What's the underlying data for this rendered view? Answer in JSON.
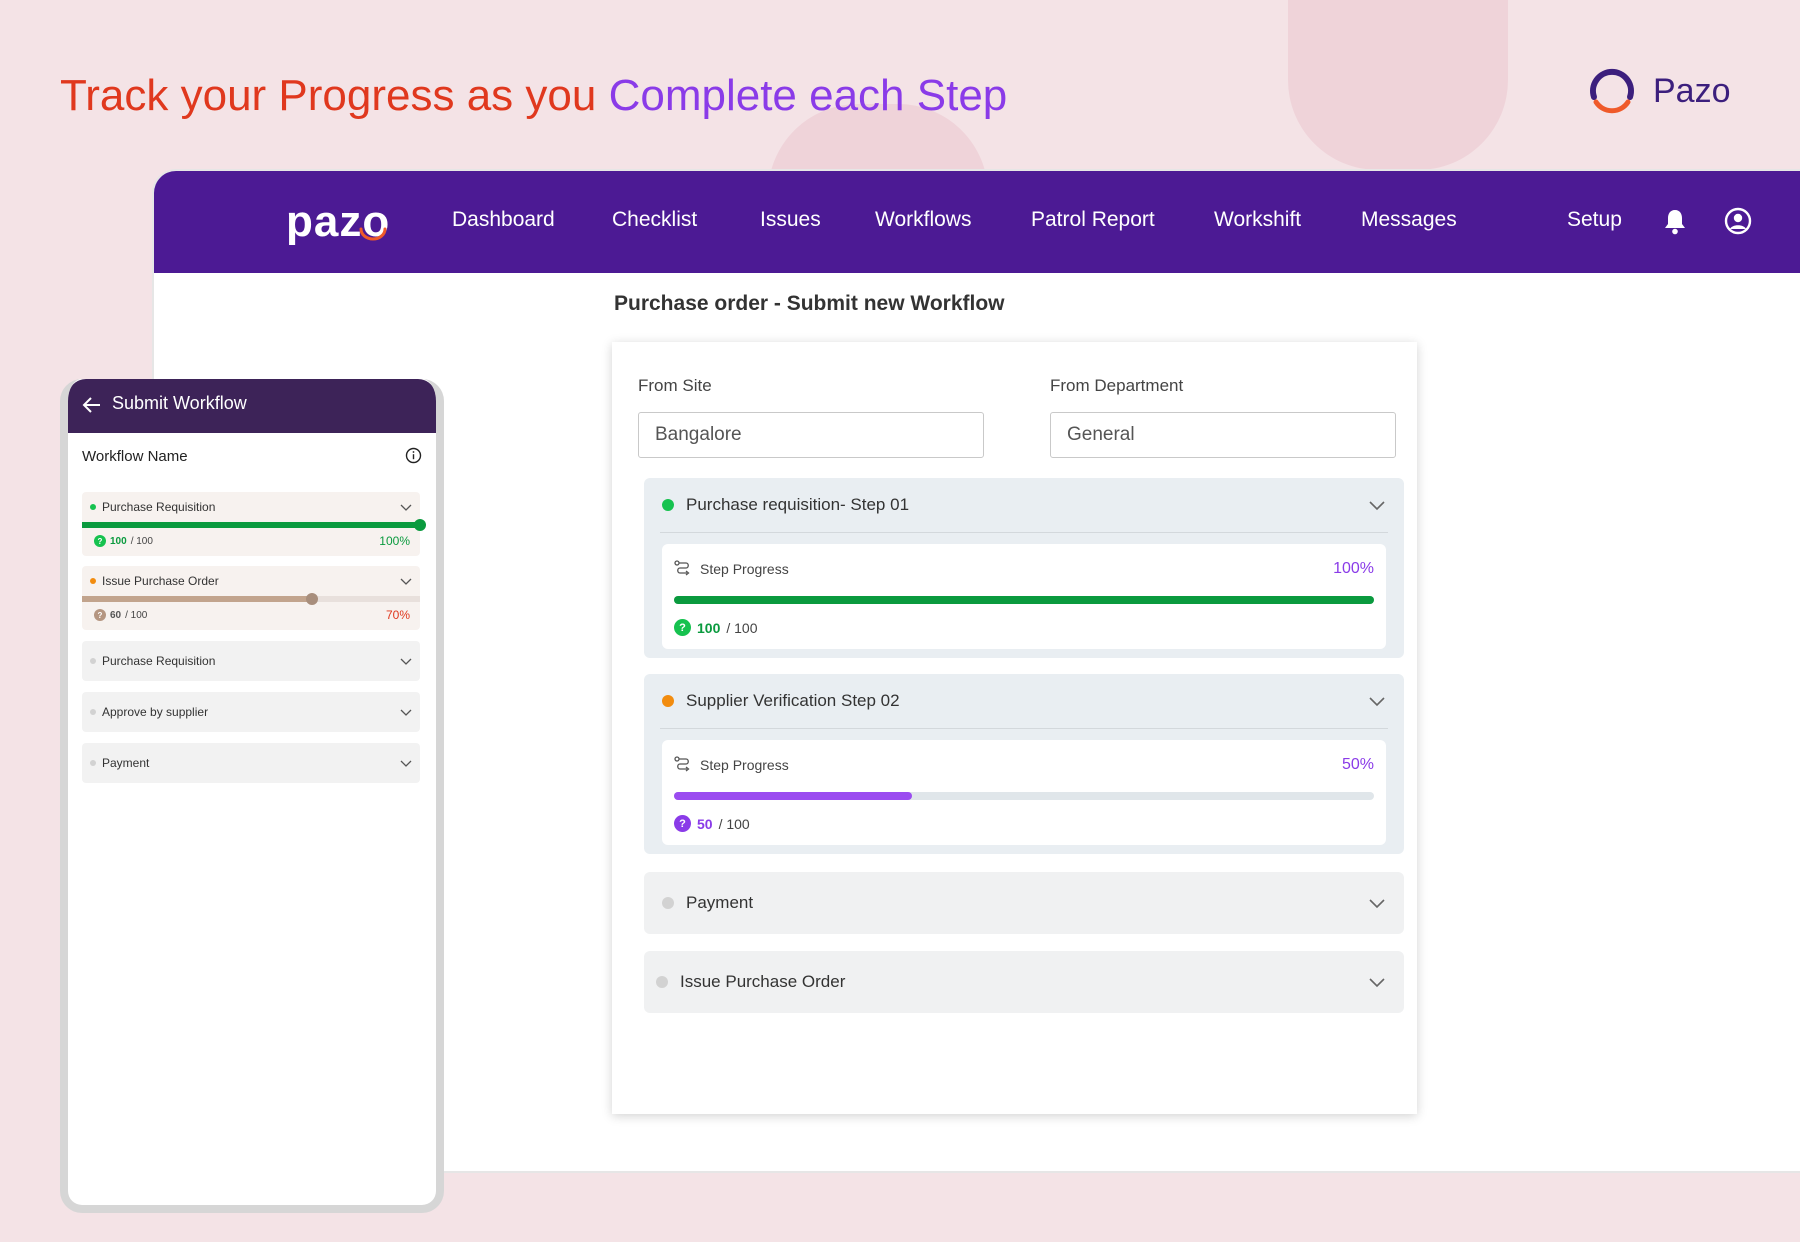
{
  "headline": {
    "part1": "Track your Progress as you",
    "part2": "Complete each Step"
  },
  "brand": {
    "name": "Pazo"
  },
  "colors": {
    "nav": "#4c1a94",
    "headline_red": "#e0381e",
    "headline_purple": "#8a3be8",
    "green": "#0a9a3e",
    "orange": "#f28c0f",
    "purple": "#8a3be8",
    "grey_dot": "#d2d2d2"
  },
  "desktop": {
    "logo": "pazo",
    "nav": [
      "Dashboard",
      "Checklist",
      "Issues",
      "Workflows",
      "Patrol Report",
      "Workshift",
      "Messages",
      "Setup"
    ],
    "icons": [
      "bell-icon",
      "user-circle-icon"
    ],
    "page_title": "Purchase order - Submit new Workflow",
    "form": {
      "from_site_label": "From Site",
      "from_site_value": "Bangalore",
      "from_department_label": "From Department",
      "from_department_value": "General"
    },
    "steps": [
      {
        "title": "Purchase requisition- Step 01",
        "progress_label": "Step Progress",
        "percent_text": "100%",
        "fraction": 1.0,
        "score": "100",
        "total": "/ 100"
      },
      {
        "title": "Supplier Verification Step 02",
        "progress_label": "Step Progress",
        "percent_text": "50%",
        "fraction": 0.34,
        "score": "50",
        "total": "/ 100"
      },
      {
        "title": "Payment"
      },
      {
        "title": "Issue Purchase Order"
      }
    ]
  },
  "mobile": {
    "title": "Submit Workflow",
    "workflow_name_label": "Workflow Name",
    "items": [
      {
        "title": "Purchase Requisition",
        "score": "100",
        "total": "/ 100",
        "percent_text": "100%",
        "fraction": 1.0
      },
      {
        "title": "Issue Purchase Order",
        "score": "60",
        "total": "/ 100",
        "percent_text": "70%",
        "fraction": 0.68
      },
      {
        "title": "Purchase Requisition"
      },
      {
        "title": "Approve by supplier"
      },
      {
        "title": "Payment"
      }
    ]
  }
}
